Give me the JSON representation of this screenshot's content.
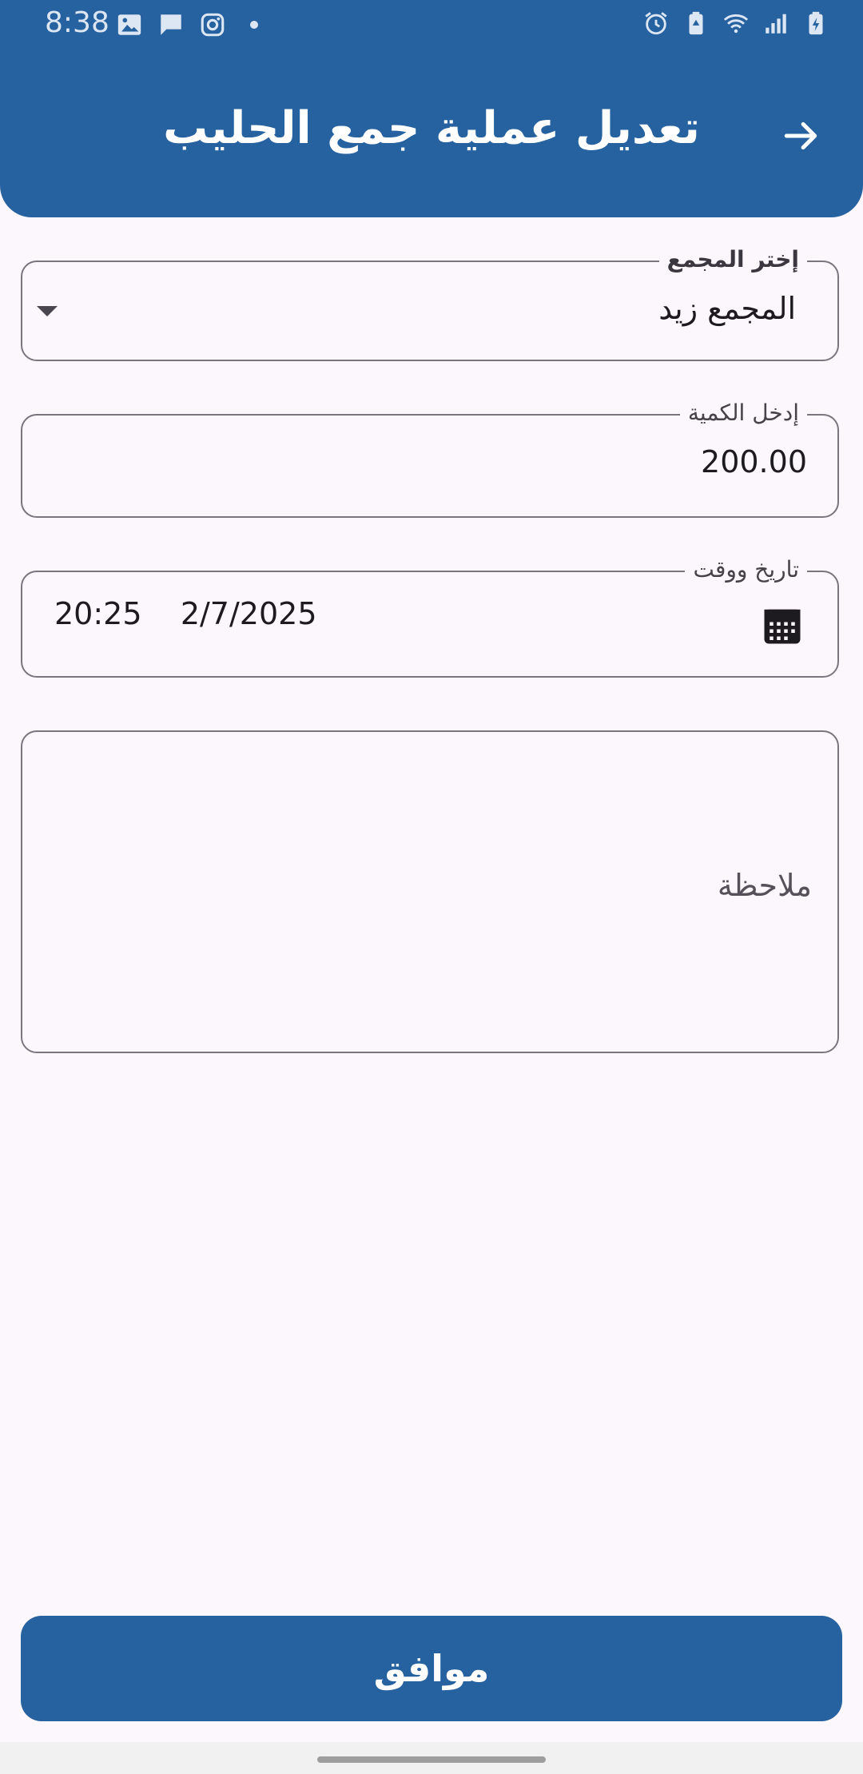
{
  "status_bar": {
    "time": "8:38",
    "left_icons": [
      "image-icon",
      "message-icon",
      "instagram-icon",
      "notification-dot"
    ],
    "right_icons": [
      "alarm-icon",
      "battery-saver-icon",
      "wifi-icon",
      "signal-icon",
      "battery-charging-icon"
    ]
  },
  "header": {
    "title": "تعديل عملية جمع الحليب",
    "back_icon": "arrow-right-icon"
  },
  "form": {
    "collector": {
      "label": "إختر المجمع",
      "value": "المجمع زيد"
    },
    "quantity": {
      "label": "إدخل الكمية",
      "value": "200.00"
    },
    "datetime": {
      "label": "تاريخ ووقت",
      "value": "20:25    2/7/2025",
      "icon": "calendar-icon"
    },
    "note": {
      "placeholder": "ملاحظة"
    }
  },
  "actions": {
    "ok_label": "موافق"
  },
  "colors": {
    "primary": "#2661a0",
    "background": "#fcf6fd",
    "outline": "#7a757f"
  }
}
